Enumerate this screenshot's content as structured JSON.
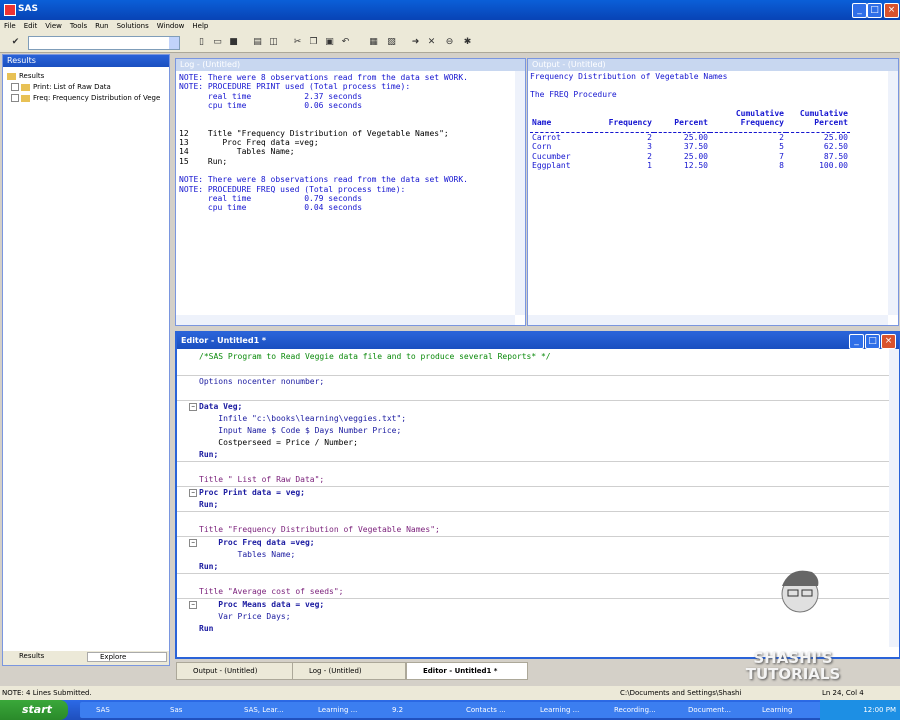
{
  "window": {
    "title": "SAS"
  },
  "menu": [
    "File",
    "Edit",
    "View",
    "Tools",
    "Run",
    "Solutions",
    "Window",
    "Help"
  ],
  "results": {
    "title": "Results",
    "tree": [
      {
        "label": "Results"
      },
      {
        "label": "Print:  List of Raw Data"
      },
      {
        "label": "Freq:  Frequency Distribution of Vege"
      }
    ],
    "tabs": [
      "Results",
      "Explore"
    ]
  },
  "log": {
    "title": "Log - (Untitled)",
    "lines": [
      {
        "text": "NOTE: There were 8 observations read from the data set WORK.",
        "cls": "blue"
      },
      {
        "text": "NOTE: PROCEDURE PRINT used (Total process time):",
        "cls": "blue"
      },
      {
        "text": "      real time           2.37 seconds",
        "cls": "blue"
      },
      {
        "text": "      cpu time            0.06 seconds",
        "cls": "blue"
      },
      {
        "text": "",
        "cls": ""
      },
      {
        "text": "",
        "cls": ""
      },
      {
        "text": "12    Title \"Frequency Distribution of Vegetable Names\";",
        "cls": ""
      },
      {
        "text": "13       Proc Freq data =veg;",
        "cls": ""
      },
      {
        "text": "14          Tables Name;",
        "cls": ""
      },
      {
        "text": "15    Run;",
        "cls": ""
      },
      {
        "text": "",
        "cls": ""
      },
      {
        "text": "NOTE: There were 8 observations read from the data set WORK.",
        "cls": "blue"
      },
      {
        "text": "NOTE: PROCEDURE FREQ used (Total process time):",
        "cls": "blue"
      },
      {
        "text": "      real time           0.79 seconds",
        "cls": "blue"
      },
      {
        "text": "      cpu time            0.04 seconds",
        "cls": "blue"
      }
    ]
  },
  "output": {
    "title": "Output - (Untitled)",
    "heading": "Frequency Distribution of Vegetable Names",
    "procedure": "The FREQ Procedure",
    "columns": [
      "Name",
      "Frequency",
      "Percent",
      "Cumulative Frequency",
      "Cumulative Percent"
    ],
    "column_header_lines": [
      [
        "",
        "",
        "",
        "Cumulative",
        "Cumulative"
      ],
      [
        "Name",
        "Frequency",
        "Percent",
        "Frequency",
        "Percent"
      ]
    ],
    "rows": [
      [
        "Carrot",
        "2",
        "25.00",
        "2",
        "25.00"
      ],
      [
        "Corn",
        "3",
        "37.50",
        "5",
        "62.50"
      ],
      [
        "Cucumber",
        "2",
        "25.00",
        "7",
        "87.50"
      ],
      [
        "Eggplant",
        "1",
        "12.50",
        "8",
        "100.00"
      ]
    ]
  },
  "editor": {
    "title": "Editor - Untitled1 *",
    "code": [
      {
        "text": "/*SAS Program to Read Veggie data file and to produce several Reports* */",
        "cls": "green",
        "mk": false,
        "sep": false
      },
      {
        "text": "",
        "cls": "",
        "mk": false,
        "sep": true
      },
      {
        "text": "Options nocenter nonumber;",
        "cls": "kw",
        "mk": false,
        "sep": false
      },
      {
        "text": "",
        "cls": "",
        "mk": false,
        "sep": true
      },
      {
        "text": "Data Veg;",
        "cls": "navy",
        "mk": true,
        "sep": false
      },
      {
        "text": "    Infile \"c:\\books\\learning\\veggies.txt\";",
        "cls": "kw",
        "mk": false,
        "sep": false
      },
      {
        "text": "    Input Name $ Code $ Days Number Price;",
        "cls": "kw",
        "mk": false,
        "sep": false
      },
      {
        "text": "    Costperseed = Price / Number;",
        "cls": "",
        "mk": false,
        "sep": false
      },
      {
        "text": "Run;",
        "cls": "navy",
        "mk": false,
        "sep": true
      },
      {
        "text": "",
        "cls": "",
        "mk": false,
        "sep": false
      },
      {
        "text": "Title \" List of Raw Data\";",
        "cls": "str",
        "mk": false,
        "sep": true
      },
      {
        "text": "Proc Print data = veg;",
        "cls": "navy",
        "mk": true,
        "sep": false
      },
      {
        "text": "Run;",
        "cls": "navy",
        "mk": false,
        "sep": true
      },
      {
        "text": "",
        "cls": "",
        "mk": false,
        "sep": false
      },
      {
        "text": "Title \"Frequency Distribution of Vegetable Names\";",
        "cls": "str",
        "mk": false,
        "sep": true
      },
      {
        "text": "    Proc Freq data =veg;",
        "cls": "navy",
        "mk": true,
        "sep": false
      },
      {
        "text": "        Tables Name;",
        "cls": "kw",
        "mk": false,
        "sep": false
      },
      {
        "text": "Run;",
        "cls": "navy",
        "mk": false,
        "sep": true
      },
      {
        "text": "",
        "cls": "",
        "mk": false,
        "sep": false
      },
      {
        "text": "Title \"Average cost of seeds\";",
        "cls": "str",
        "mk": false,
        "sep": true
      },
      {
        "text": "    Proc Means data = veg;",
        "cls": "navy",
        "mk": true,
        "sep": false
      },
      {
        "text": "    Var Price Days;",
        "cls": "kw",
        "mk": false,
        "sep": false
      },
      {
        "text": "Run",
        "cls": "navy",
        "mk": false,
        "sep": false
      }
    ]
  },
  "window_tabs": [
    "Output - (Untitled)",
    "Log - (Untitled)",
    "Editor - Untitled1 *"
  ],
  "status": {
    "left": "NOTE: 4 Lines Submitted.",
    "path": "C:\\Documents and Settings\\Shashi",
    "position": "Ln 24, Col 4"
  },
  "taskbar": {
    "start": "start",
    "tasks": [
      "SAS",
      "Sas",
      "SAS, Lear...",
      "Learning ...",
      "9.2",
      "Contacts ...",
      "Learning ...",
      "Recording...",
      "Document...",
      "Learning"
    ],
    "clock": "12:00 PM"
  },
  "watermark": {
    "line1": "SHASHI'S",
    "line2": "TUTORIALS"
  }
}
